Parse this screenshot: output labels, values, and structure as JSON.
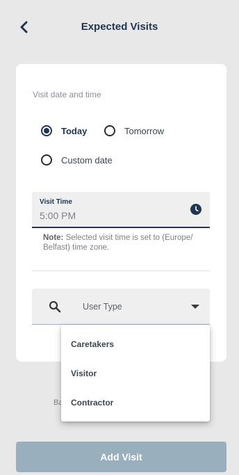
{
  "header": {
    "title": "Expected Visits",
    "back_icon": "chevron-left-icon"
  },
  "form": {
    "section_label": "Visit date and time",
    "date_options": [
      {
        "label": "Today",
        "selected": true
      },
      {
        "label": "Tomorrow",
        "selected": false
      },
      {
        "label": "Custom date",
        "selected": false
      }
    ],
    "visit_time": {
      "label": "Visit Time",
      "value": "5:00 PM",
      "icon": "clock-icon"
    },
    "note": {
      "prefix": "Note:",
      "text": " Selected visit time is set to (Europe/ Belfast) time zone."
    },
    "user_type": {
      "placeholder": "User Type",
      "icon": "search-icon",
      "dropdown_icon": "caret-down-icon"
    },
    "partial_label": "Ba"
  },
  "dropdown": {
    "options": [
      "Caretakers",
      "Visitor",
      "Contractor"
    ]
  },
  "footer": {
    "add_button_label": "Add Visit"
  },
  "colors": {
    "primary": "#1f3550",
    "button_disabled": "#9aafbd",
    "background": "#e8e8e8"
  }
}
